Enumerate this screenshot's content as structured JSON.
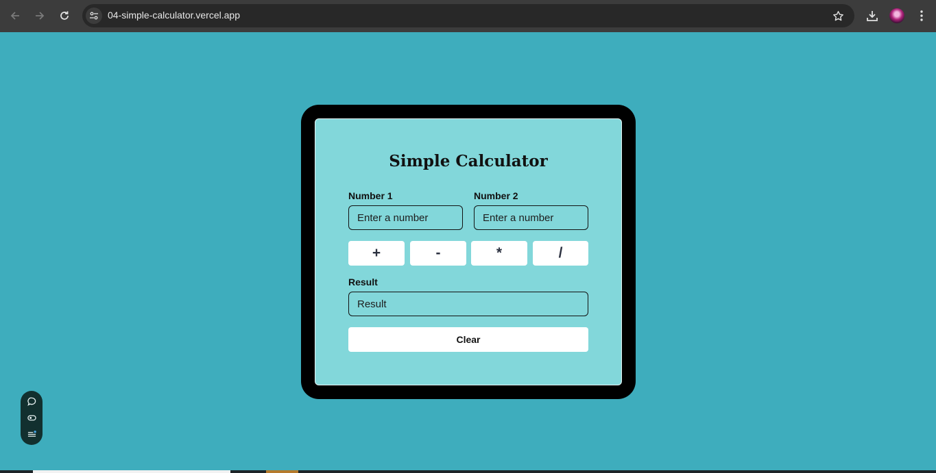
{
  "browser": {
    "url": "04-simple-calculator.vercel.app",
    "icons": [
      "back-icon",
      "forward-icon",
      "reload-icon",
      "site-info-icon",
      "bookmark-star-icon",
      "download-icon",
      "profile-avatar",
      "kebab-menu-icon"
    ]
  },
  "calculator": {
    "title": "Simple Calculator",
    "number1": {
      "label": "Number 1",
      "placeholder": "Enter a number",
      "value": ""
    },
    "number2": {
      "label": "Number 2",
      "placeholder": "Enter a number",
      "value": ""
    },
    "operators": [
      "+",
      "-",
      "*",
      "/"
    ],
    "result": {
      "label": "Result",
      "placeholder": "Result",
      "value": ""
    },
    "clear_label": "Clear"
  },
  "floating_toolbar": {
    "icons": [
      "comment-icon",
      "eye-toggle-icon",
      "list-icon"
    ]
  },
  "colors": {
    "page_background": "#3eadbd",
    "card_background": "#82d7da",
    "frame": "#000000",
    "browser_chrome": "#3c3c3c"
  }
}
